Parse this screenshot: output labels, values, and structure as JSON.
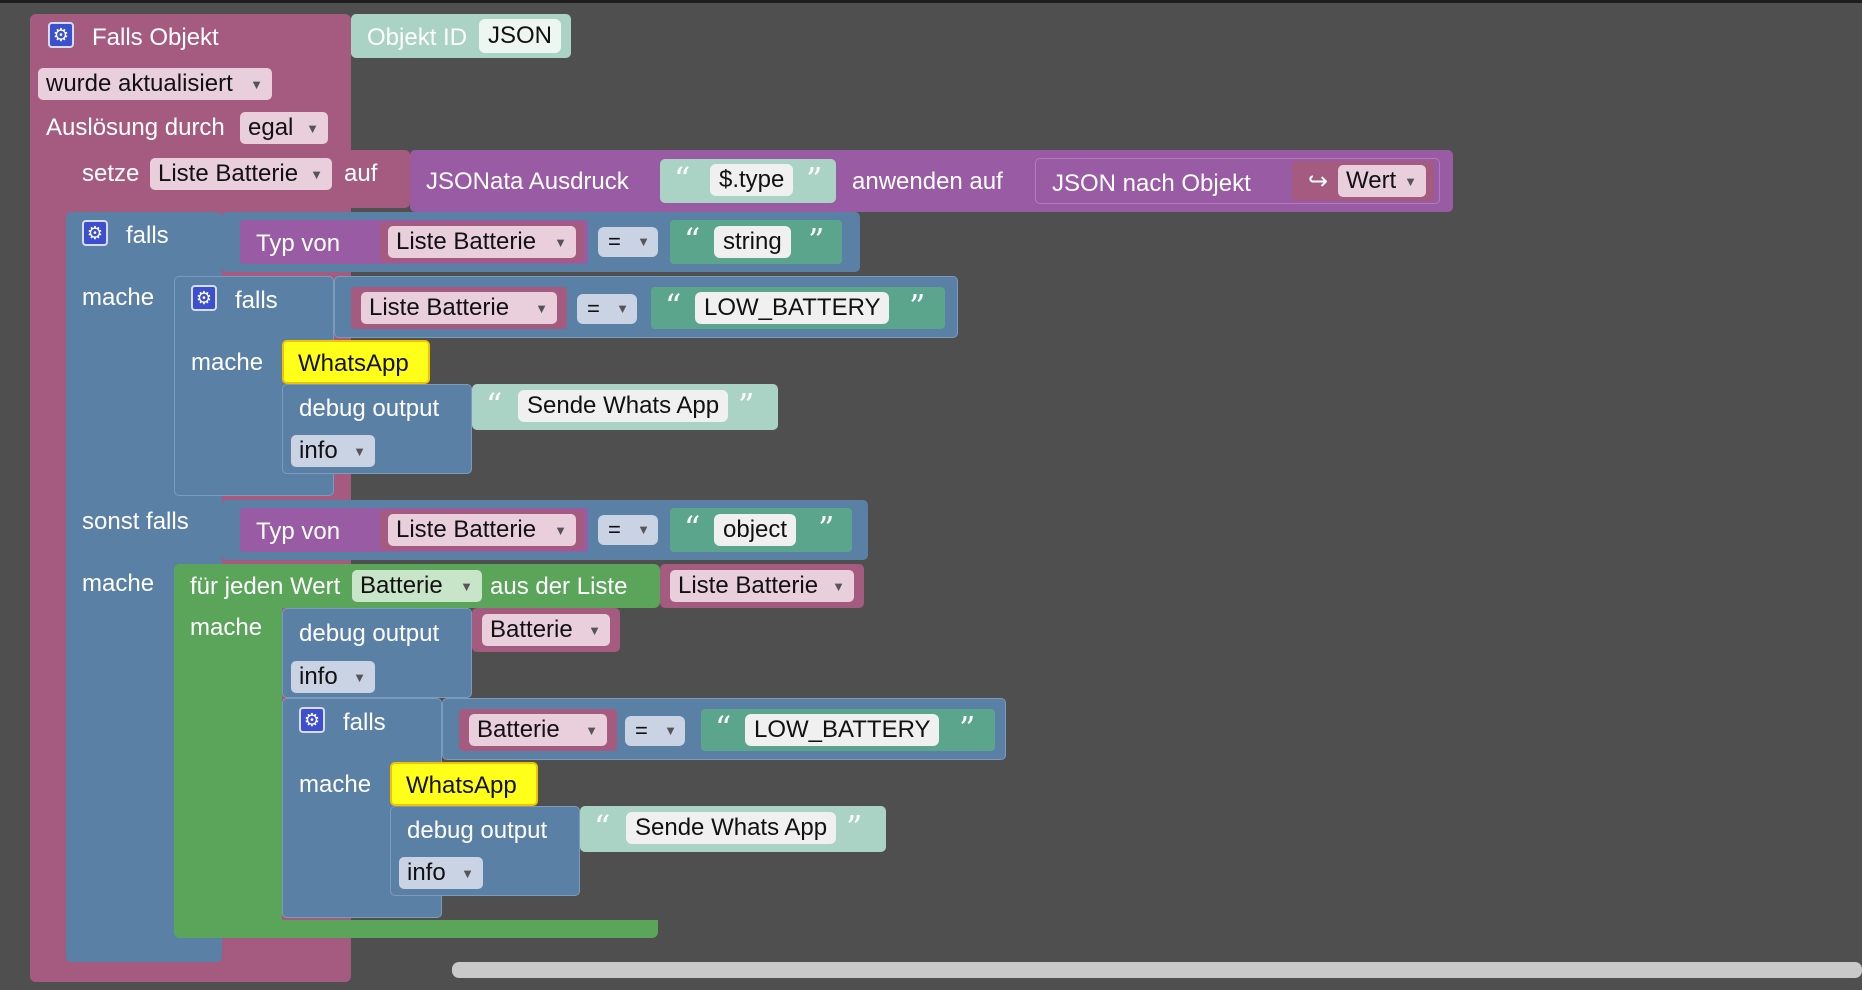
{
  "colors": {
    "event": "#a55b80",
    "logic": "#5b80a5",
    "loop": "#5ba55b",
    "json_purple": "#9a5ba5",
    "text_green": "#5ba58c",
    "objid_green": "#aad3c5",
    "whatsapp_yellow": "#ffff1a",
    "workspace": "#4f4f4f"
  },
  "trigger": {
    "title": "Falls Objekt",
    "object_id_label": "Objekt ID",
    "object_id_value": "JSON",
    "event_mode": "wurde aktualisiert",
    "trigger_by_label": "Auslösung durch",
    "trigger_by_value": "egal"
  },
  "set_block": {
    "label": "setze",
    "variable": "Liste Batterie",
    "to_label": "auf",
    "jsonata_label": "JSONata Ausdruck",
    "expression": "$.type",
    "apply_label": "anwenden auf",
    "json_to_object_label": "JSON nach Objekt",
    "value_icon": "↪",
    "value": "Wert"
  },
  "if_outer": {
    "if_label": "falls",
    "do_label": "mache",
    "elseif_label": "sonst falls",
    "cond1": {
      "typeof_label": "Typ von",
      "variable": "Liste Batterie",
      "op": "=",
      "text": "string"
    },
    "cond2": {
      "typeof_label": "Typ von",
      "variable": "Liste Batterie",
      "op": "=",
      "text": "object"
    }
  },
  "if_inner1": {
    "if_label": "falls",
    "do_label": "mache",
    "variable": "Liste Batterie",
    "op": "=",
    "text": "LOW_BATTERY",
    "whatsapp_label": "WhatsApp",
    "debug_label": "debug output",
    "debug_text": "Sende Whats App",
    "level": "info"
  },
  "foreach": {
    "label": "für jeden Wert",
    "variable": "Batterie",
    "from_label": "aus der Liste",
    "list": "Liste Batterie",
    "do_label": "mache",
    "debug_label": "debug output",
    "debug_var": "Batterie",
    "level": "info"
  },
  "if_inner2": {
    "if_label": "falls",
    "do_label": "mache",
    "variable": "Batterie",
    "op": "=",
    "text": "LOW_BATTERY",
    "whatsapp_label": "WhatsApp",
    "debug_label": "debug output",
    "debug_text": "Sende Whats App",
    "level": "info"
  },
  "icons": {
    "gear": "gear-icon",
    "dropdown": "chevron-down-icon",
    "quote_open": "“",
    "quote_close": "”"
  }
}
